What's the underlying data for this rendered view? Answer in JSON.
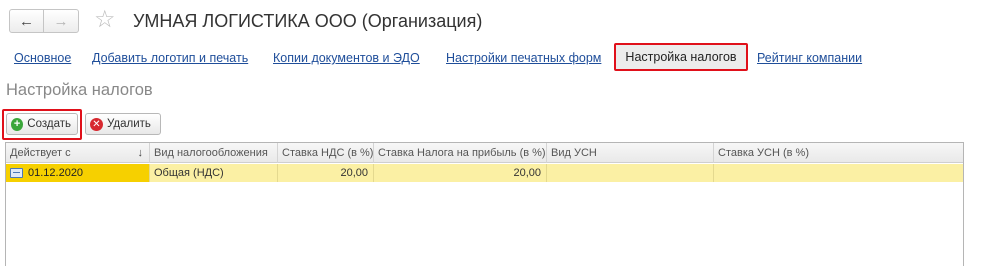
{
  "window": {
    "title": "УМНАЯ ЛОГИСТИКА ООО (Организация)",
    "back_icon": "arrow-left-icon",
    "forward_icon": "arrow-right-icon",
    "favorite_icon": "star-icon"
  },
  "tabs": [
    {
      "label": "Основное",
      "active": false
    },
    {
      "label": "Добавить логотип и печать",
      "active": false
    },
    {
      "label": "Копии документов и ЭДО",
      "active": false
    },
    {
      "label": "Настройки печатных форм",
      "active": false
    },
    {
      "label": "Настройка налогов",
      "active": true
    },
    {
      "label": "Рейтинг компании",
      "active": false
    }
  ],
  "section": {
    "title": "Настройка налогов"
  },
  "toolbar": {
    "create_label": "Создать",
    "delete_label": "Удалить"
  },
  "table": {
    "columns": [
      "Действует с",
      "Вид налогообложения",
      "Ставка НДС (в %)",
      "Ставка Налога на прибыль (в %)",
      "Вид УСН",
      "Ставка УСН (в %)"
    ],
    "sort_indicator": "↓",
    "rows": [
      {
        "date": "01.12.2020",
        "tax_system": "Общая (НДС)",
        "vat_rate": "20,00",
        "profit_tax_rate": "20,00",
        "usn_type": "",
        "usn_rate": ""
      }
    ]
  },
  "colors": {
    "highlight": "#e0101a",
    "link": "#1f4e9a",
    "selected_row": "#fbf0a4",
    "selected_cell": "#f6d000"
  }
}
